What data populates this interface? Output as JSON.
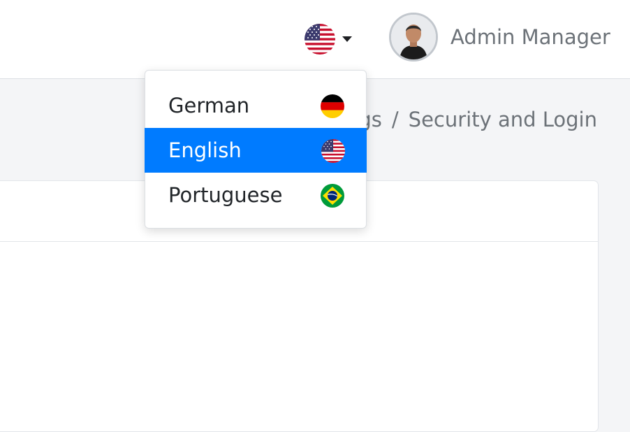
{
  "header": {
    "language_button": {
      "icon": "us-flag-icon",
      "caret_icon": "caret-down-icon"
    },
    "user": {
      "avatar": "user-avatar",
      "name": "Admin Manager"
    }
  },
  "breadcrumb": {
    "partial_prefix": "ngs",
    "separator": "/",
    "current": "Security and Login"
  },
  "language_dropdown": {
    "items": [
      {
        "label": "German",
        "icon": "germany-flag-icon",
        "selected": false
      },
      {
        "label": "English",
        "icon": "us-flag-icon",
        "selected": true
      },
      {
        "label": "Portuguese",
        "icon": "brazil-flag-icon",
        "selected": false
      }
    ]
  },
  "colors": {
    "accent": "#007bff",
    "header_bg": "#ffffff",
    "page_bg": "#f4f5f7",
    "muted_text": "#6c7278"
  }
}
